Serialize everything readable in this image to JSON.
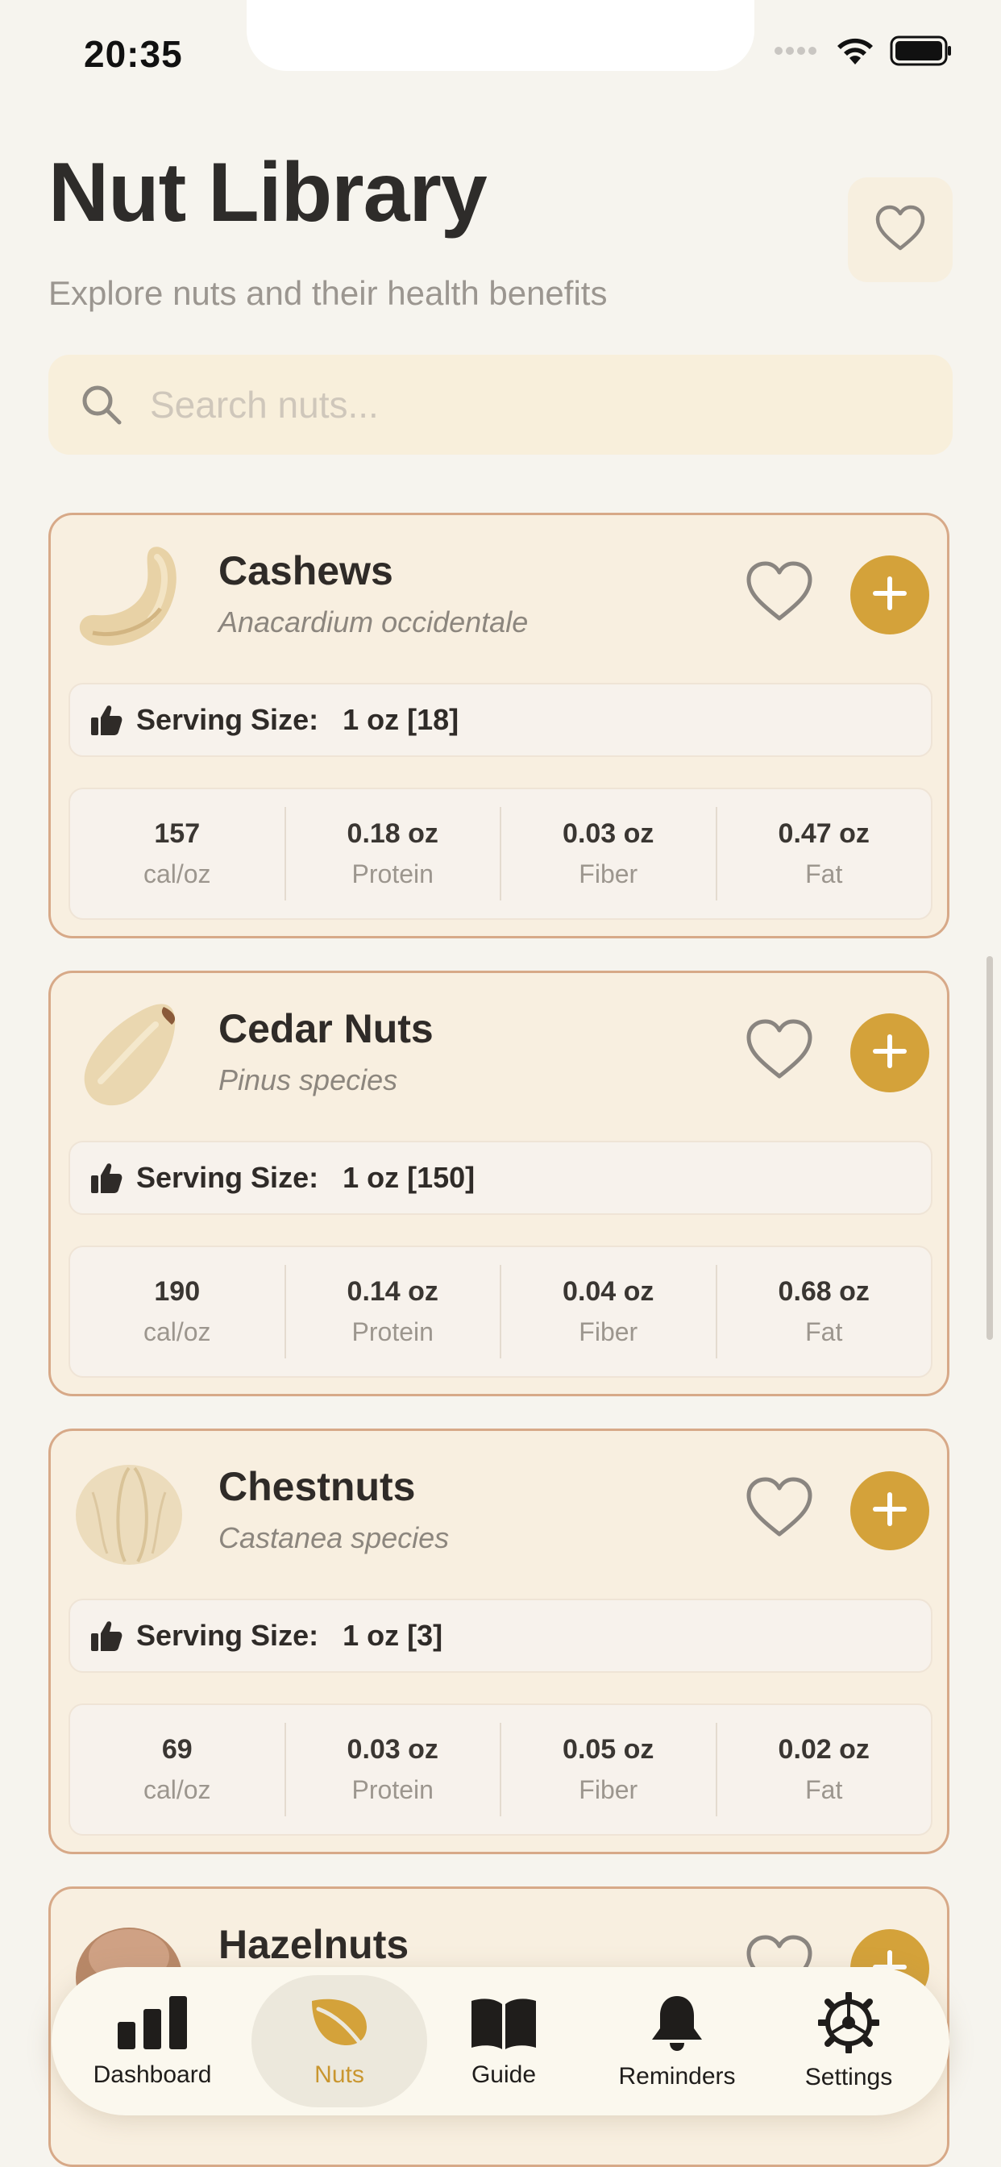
{
  "status_bar": {
    "time": "20:35"
  },
  "header": {
    "title": "Nut Library",
    "subtitle": "Explore nuts and their health benefits"
  },
  "search": {
    "placeholder": "Search nuts..."
  },
  "serving_label": "Serving Size:",
  "nuts": [
    {
      "name": "Cashews",
      "scientific": "Anacardium occidentale",
      "serving": "1 oz [18]",
      "stats": [
        {
          "value": "157",
          "label": "cal/oz"
        },
        {
          "value": "0.18 oz",
          "label": "Protein"
        },
        {
          "value": "0.03 oz",
          "label": "Fiber"
        },
        {
          "value": "0.47 oz",
          "label": "Fat"
        }
      ]
    },
    {
      "name": "Cedar Nuts",
      "scientific": "Pinus species",
      "serving": "1 oz [150]",
      "stats": [
        {
          "value": "190",
          "label": "cal/oz"
        },
        {
          "value": "0.14 oz",
          "label": "Protein"
        },
        {
          "value": "0.04 oz",
          "label": "Fiber"
        },
        {
          "value": "0.68 oz",
          "label": "Fat"
        }
      ]
    },
    {
      "name": "Chestnuts",
      "scientific": "Castanea species",
      "serving": "1 oz [3]",
      "stats": [
        {
          "value": "69",
          "label": "cal/oz"
        },
        {
          "value": "0.03 oz",
          "label": "Protein"
        },
        {
          "value": "0.05 oz",
          "label": "Fiber"
        },
        {
          "value": "0.02 oz",
          "label": "Fat"
        }
      ]
    },
    {
      "name": "Hazelnuts"
    }
  ],
  "tabs": [
    {
      "label": "Dashboard",
      "icon": "bar-chart-icon"
    },
    {
      "label": "Nuts",
      "icon": "leaf-icon",
      "active": true
    },
    {
      "label": "Guide",
      "icon": "book-icon"
    },
    {
      "label": "Reminders",
      "icon": "bell-icon"
    },
    {
      "label": "Settings",
      "icon": "gear-icon"
    }
  ],
  "colors": {
    "accent": "#d4a23a",
    "card_border": "#d7a988",
    "card_bg": "#f8efe0",
    "background": "#f6f4ee"
  }
}
